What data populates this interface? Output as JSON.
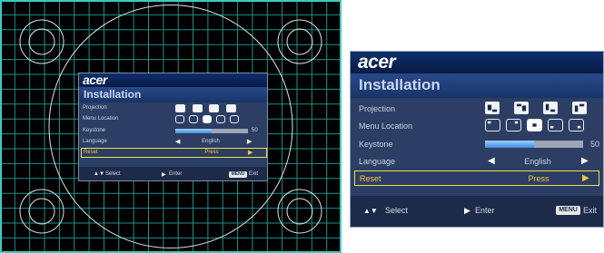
{
  "osd": {
    "logo": "acer",
    "title": "Installation",
    "rows": [
      {
        "label": "Projection"
      },
      {
        "label": "Menu Location"
      },
      {
        "label": "Keystone",
        "value": "50",
        "level": 0.5
      },
      {
        "label": "Language",
        "value": "English"
      },
      {
        "label": "Reset",
        "value": "Press"
      }
    ],
    "selected_row": "Reset",
    "projection_icons": [
      "front-desktop-icon",
      "front-ceiling-icon",
      "rear-desktop-icon",
      "rear-ceiling-icon"
    ],
    "menu_location_icons": [
      "top-left-icon",
      "top-right-icon",
      "center-icon",
      "bottom-left-icon",
      "bottom-right-icon"
    ],
    "menu_location_selected": "center-icon",
    "footer": {
      "select_label": "Select",
      "enter_label": "Enter",
      "menu_key": "MENU",
      "exit_label": "Exit"
    }
  },
  "colors": {
    "pattern_bg": "#000000",
    "pattern_lines": "#1e8f8a",
    "osd_bg": "#2c3e63",
    "osd_title_bar": "#183468",
    "highlight": "#f2c54a",
    "keystone_fill": "#3e8de0"
  }
}
